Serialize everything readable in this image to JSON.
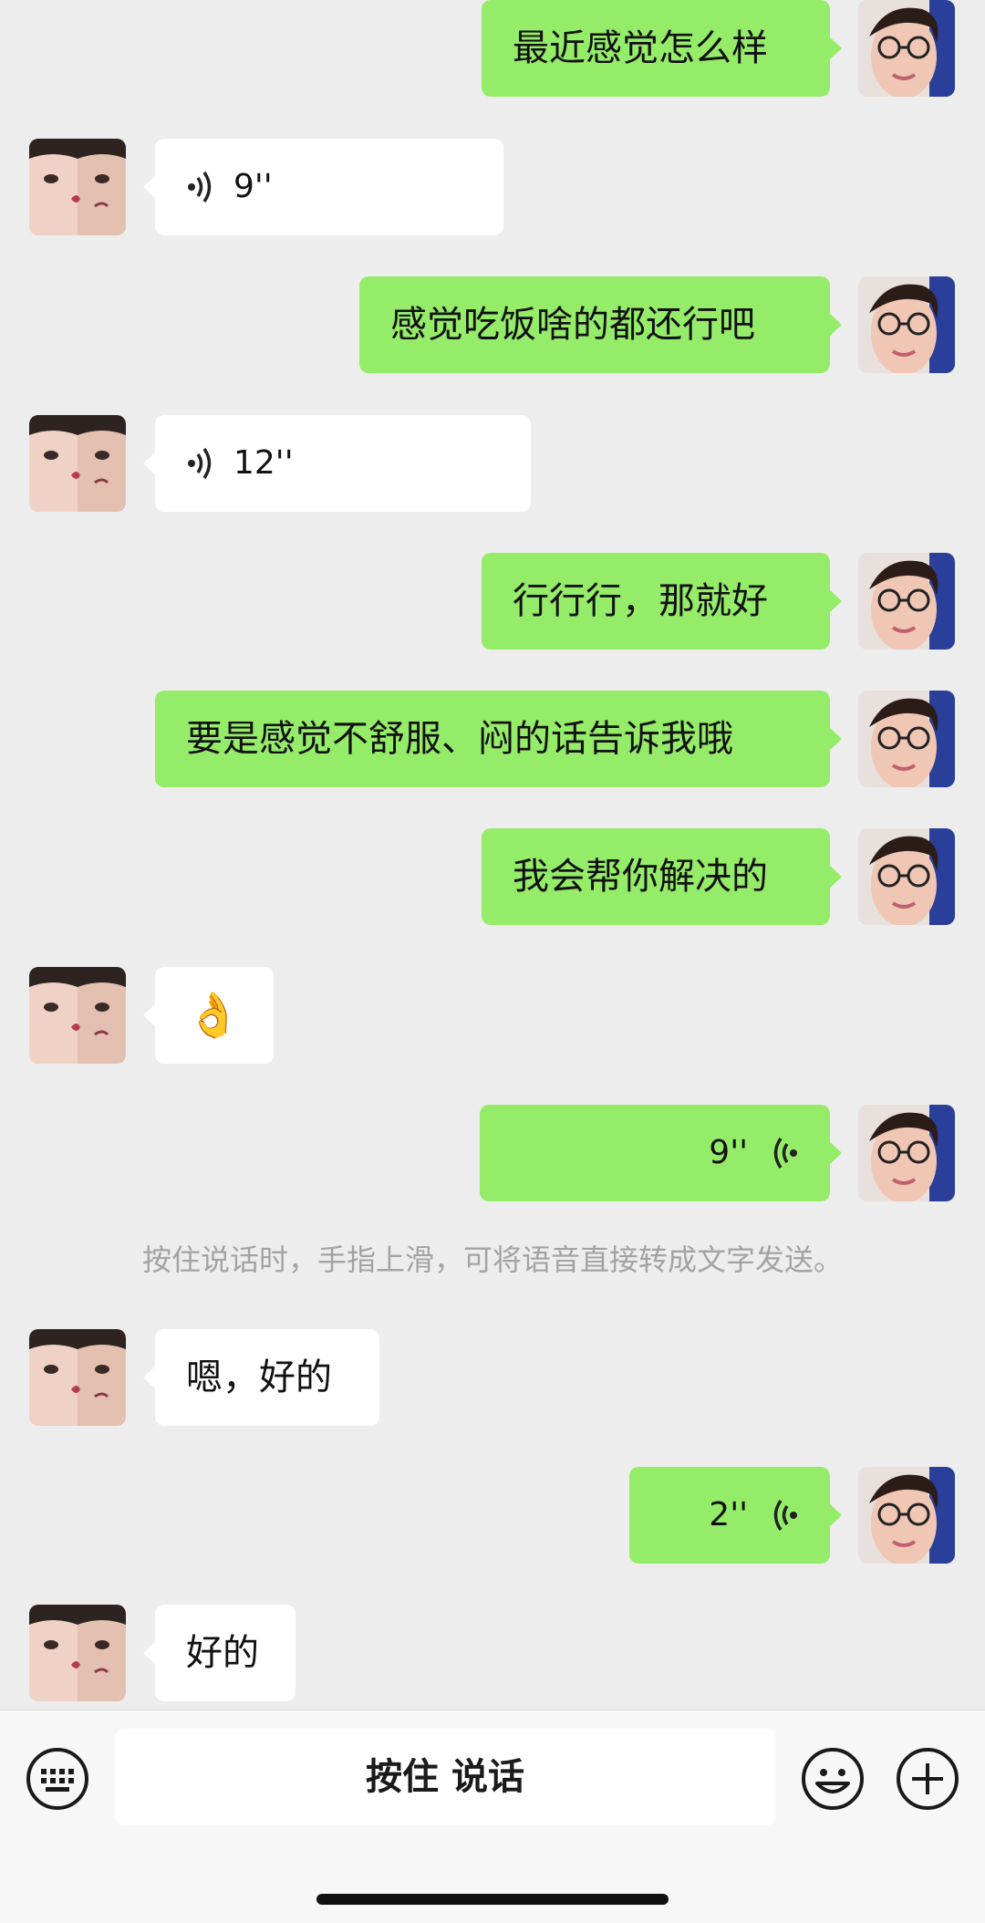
{
  "messages": [
    {
      "side": "out",
      "type": "text",
      "text": "最近感觉怎么样"
    },
    {
      "side": "in",
      "type": "voice",
      "duration": "9''"
    },
    {
      "side": "out",
      "type": "text",
      "text": "感觉吃饭啥的都还行吧"
    },
    {
      "side": "in",
      "type": "voice",
      "duration": "12''"
    },
    {
      "side": "out",
      "type": "text",
      "text": "行行行，那就好"
    },
    {
      "side": "out",
      "type": "text",
      "text": "要是感觉不舒服、闷的话告诉我哦"
    },
    {
      "side": "out",
      "type": "text",
      "text": "我会帮你解决的"
    },
    {
      "side": "in",
      "type": "emoji",
      "text": "👌"
    },
    {
      "side": "out",
      "type": "voice",
      "duration": "9''"
    },
    {
      "side": "in",
      "type": "text",
      "text": "嗯，好的"
    },
    {
      "side": "out",
      "type": "voice",
      "duration": "2''"
    },
    {
      "side": "in",
      "type": "text",
      "text": "好的"
    }
  ],
  "system_tip": "按住说话时，手指上滑，可将语音直接转成文字发送。",
  "toolbar": {
    "hold_to_talk": "按住 说话",
    "left_icon": "keyboard-icon",
    "right_icons": [
      "emoji-icon",
      "plus-icon"
    ]
  },
  "colors": {
    "background": "#ededed",
    "outgoing_bubble": "#95ec69",
    "incoming_bubble": "#ffffff",
    "toolbar": "#f7f7f7"
  }
}
